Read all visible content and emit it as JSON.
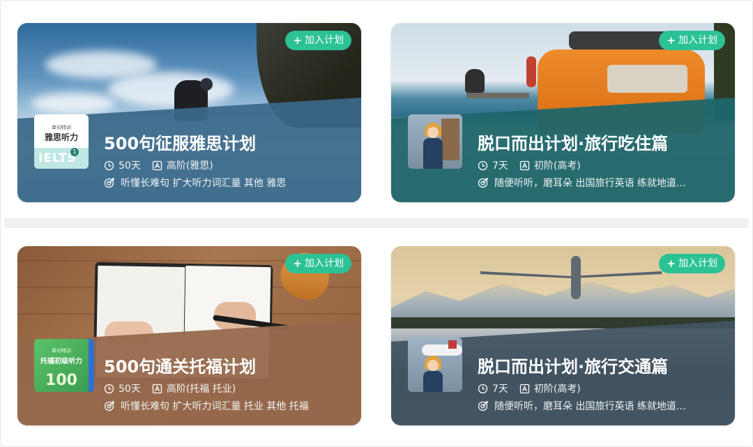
{
  "cards": [
    {
      "button": "加入计划",
      "title": "500句征服雅思计划",
      "duration": "50天",
      "level": "高阶(雅思)",
      "description": "听懂长难句 扩大听力词汇量 其他 雅思",
      "thumb": {
        "tag": "单句特训",
        "title": "雅思听力",
        "logo": "IELTS",
        "number": "1"
      },
      "overlay_color": "#3a6889"
    },
    {
      "button": "加入计划",
      "title": "脱口而出计划·旅行吃住篇",
      "duration": "7天",
      "level": "初阶(高考)",
      "description": "随便听听，磨耳朵 出国旅行英语 练就地道…",
      "overlay_color": "#1f666c"
    },
    {
      "button": "加入计划",
      "title": "500句通关托福计划",
      "duration": "50天",
      "level": "高阶(托福 托业)",
      "description": "听懂长难句 扩大听力词汇量 托业 其他 托福",
      "thumb": {
        "tag": "单句特训",
        "title": "托福初级听力",
        "number": "100"
      },
      "overlay_color": "#96684c"
    },
    {
      "button": "加入计划",
      "title": "脱口而出计划·旅行交通篇",
      "duration": "7天",
      "level": "初阶(高考)",
      "description": "随便听听，磨耳朵 出国旅行英语 练就地道…",
      "overlay_color": "#435463"
    }
  ],
  "colors": {
    "accent_button": "#2cc197",
    "text": "#ffffff"
  },
  "icons": [
    "plus-icon",
    "clock-icon",
    "level-icon",
    "target-icon"
  ]
}
